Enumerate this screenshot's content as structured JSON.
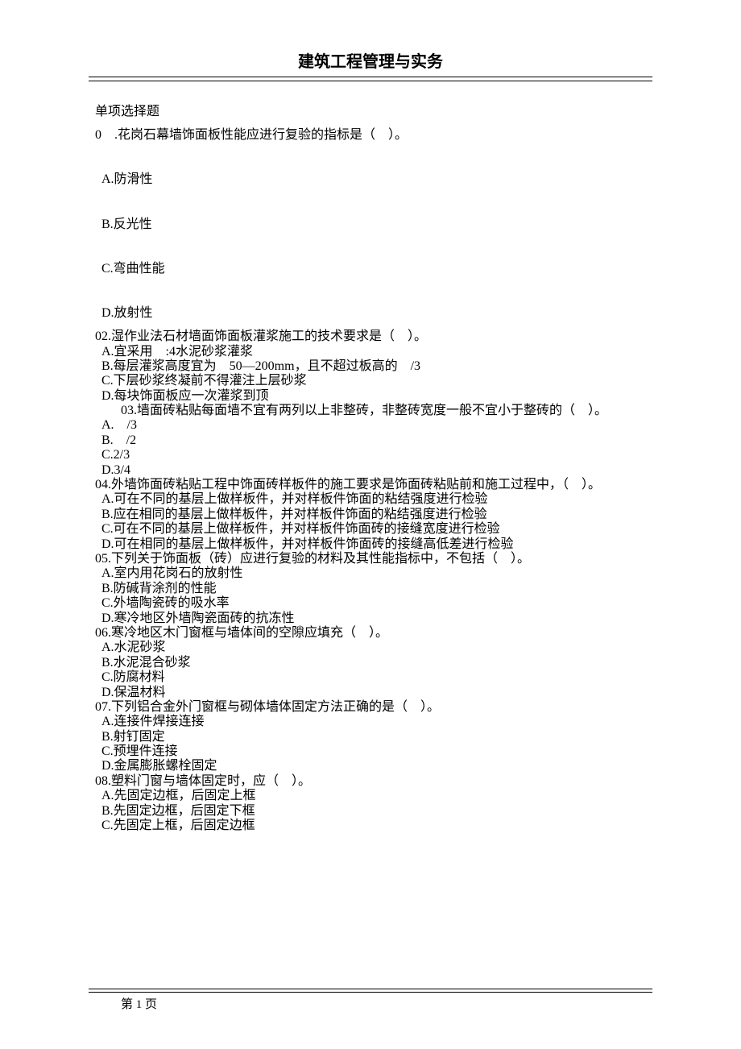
{
  "header": {
    "title": "建筑工程管理与实务"
  },
  "section_label": "单项选择题",
  "q1": {
    "stem": "0　.花岗石幕墙饰面板性能应进行复验的指标是（　）。",
    "a": "A.防滑性",
    "b": "B.反光性",
    "c": "C.弯曲性能",
    "d": "D.放射性"
  },
  "q2": {
    "stem": "02.湿作业法石材墙面饰面板灌浆施工的技术要求是（　）。",
    "a": "A.宜采用　:4水泥砂浆灌浆",
    "b": "B.每层灌浆高度宜为　50—200mm，且不超过板高的　/3",
    "c": "C.下层砂浆终凝前不得灌注上层砂浆",
    "d": "D.每块饰面板应一次灌浆到顶"
  },
  "q3": {
    "stem": "　　03.墙面砖粘贴每面墙不宜有两列以上非整砖，非整砖宽度一般不宜小于整砖的（　）。",
    "a": "A.　/3",
    "b": "B.　/2",
    "c": "C.2/3",
    "d": "D.3/4"
  },
  "q4": {
    "stem": "04.外墙饰面砖粘贴工程中饰面砖样板件的施工要求是饰面砖粘贴前和施工过程中，（　）。",
    "a": "A.可在不同的基层上做样板件，并对样板件饰面的粘结强度进行检验",
    "b": "B.应在相同的基层上做样板件，并对样板件饰面的粘结强度进行检验",
    "c": "C.可在不同的基层上做样板件，并对样板件饰面砖的接缝宽度进行检验",
    "d": "D.可在相同的基层上做样板件，并对样板件饰面砖的接缝高低差进行检验"
  },
  "q5": {
    "stem": "05.下列关于饰面板（砖）应进行复验的材料及其性能指标中，不包括（　）。",
    "a": "A.室内用花岗石的放射性",
    "b": "B.防碱背涂剂的性能",
    "c": "C.外墙陶瓷砖的吸水率",
    "d": "D.寒冷地区外墙陶瓷面砖的抗冻性"
  },
  "q6": {
    "stem": "06.寒冷地区木门窗框与墙体间的空隙应填充（　）。",
    "a": "A.水泥砂浆",
    "b": "B.水泥混合砂浆",
    "c": "C.防腐材料",
    "d": "D.保温材料"
  },
  "q7": {
    "stem": "07.下列铝合金外门窗框与砌体墙体固定方法正确的是（　）。",
    "a": "A.连接件焊接连接",
    "b": "B.射钉固定",
    "c": "C.预埋件连接",
    "d": "D.金属膨胀螺栓固定"
  },
  "q8": {
    "stem": "08.塑料门窗与墙体固定时，应（　）。",
    "a": "A.先固定边框，后固定上框",
    "b": "B.先固定边框，后固定下框",
    "c": "C.先固定上框，后固定边框"
  },
  "footer": {
    "page_label": "第 1 页"
  }
}
